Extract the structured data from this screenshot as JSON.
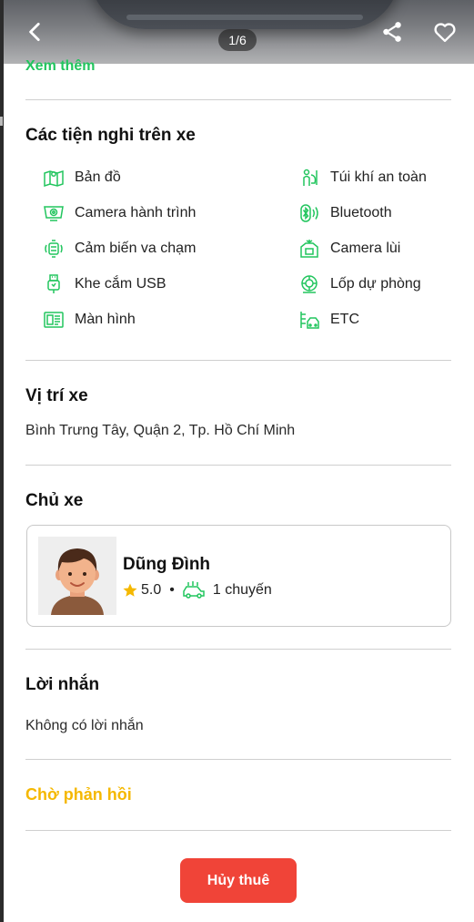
{
  "header": {
    "image_counter": "1/6"
  },
  "description": {
    "show_more_label": "Xem thêm"
  },
  "amenities": {
    "title": "Các tiện nghi trên xe",
    "items": [
      {
        "label": "Bản đồ",
        "icon": "map-icon"
      },
      {
        "label": "Túi khí an toàn",
        "icon": "airbag-icon"
      },
      {
        "label": "Camera hành trình",
        "icon": "dashcam-icon"
      },
      {
        "label": "Bluetooth",
        "icon": "bluetooth-icon"
      },
      {
        "label": "Cảm biến va chạm",
        "icon": "collision-sensor-icon"
      },
      {
        "label": "Camera lùi",
        "icon": "reverse-camera-icon"
      },
      {
        "label": "Khe cắm USB",
        "icon": "usb-icon"
      },
      {
        "label": "Lốp dự phòng",
        "icon": "spare-tire-icon"
      },
      {
        "label": "Màn hình",
        "icon": "screen-icon"
      },
      {
        "label": "ETC",
        "icon": "etc-icon"
      }
    ]
  },
  "location": {
    "title": "Vị trí xe",
    "address": "Bình Trưng Tây, Quận 2, Tp. Hồ Chí Minh"
  },
  "owner": {
    "title": "Chủ xe",
    "name": "Dũng Đình",
    "rating": "5.0",
    "separator": "•",
    "trips": "1 chuyến"
  },
  "message": {
    "title": "Lời nhắn",
    "text": "Không có lời nhắn"
  },
  "status": {
    "label": "Chờ phản hồi"
  },
  "actions": {
    "cancel_label": "Hủy thuê"
  },
  "colors": {
    "accent_green": "#22c55e",
    "status_yellow": "#f5b800",
    "danger_red": "#f04438",
    "star_gold": "#f5b800"
  }
}
